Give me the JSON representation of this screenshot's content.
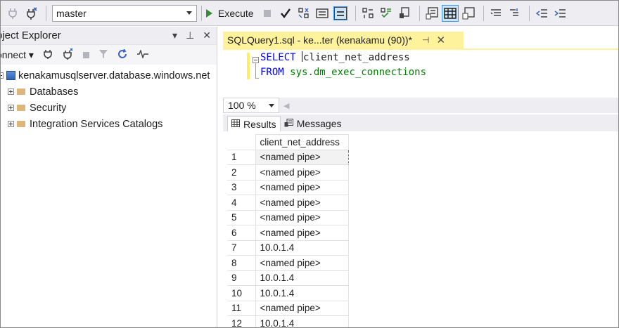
{
  "toolbar": {
    "database_value": "master",
    "execute_label": "Execute"
  },
  "object_explorer": {
    "title": "Object Explorer",
    "title_visible": "bject Explorer",
    "connect_label": "Connect",
    "connect_visible": "onnect",
    "server": "kenakamusqlserver.database.windows.net",
    "nodes": [
      "Databases",
      "Security",
      "Integration Services Catalogs"
    ]
  },
  "query": {
    "tab_title": "SQLQuery1.sql - ke...ter (kenakamu (90))*",
    "line1_keyword": "SELECT",
    "line1_rest": "client_net_address",
    "line2_keyword": "FROM",
    "line2_rest": "sys.dm_exec_connections",
    "zoom": "100 %"
  },
  "results": {
    "tab_results": "Results",
    "tab_messages": "Messages",
    "column": "client_net_address",
    "rows": [
      {
        "n": "1",
        "v": "<named pipe>"
      },
      {
        "n": "2",
        "v": "<named pipe>"
      },
      {
        "n": "3",
        "v": "<named pipe>"
      },
      {
        "n": "4",
        "v": "<named pipe>"
      },
      {
        "n": "5",
        "v": "<named pipe>"
      },
      {
        "n": "6",
        "v": "<named pipe>"
      },
      {
        "n": "7",
        "v": "10.0.1.4"
      },
      {
        "n": "8",
        "v": "<named pipe>"
      },
      {
        "n": "9",
        "v": "10.0.1.4"
      },
      {
        "n": "10",
        "v": "10.0.1.4"
      },
      {
        "n": "11",
        "v": "<named pipe>"
      },
      {
        "n": "12",
        "v": "10.0.1.4"
      }
    ]
  },
  "icons": {
    "toolbar": [
      "plug-icon",
      "disconnect-icon",
      "database-dropdown",
      "play-icon",
      "stop-icon",
      "checkmark-icon",
      "parse-icon",
      "results-to-text-icon",
      "results-to-grid-icon",
      "comment-icon",
      "uncomment-icon",
      "indent-icon",
      "outdent-icon"
    ],
    "object_explorer": [
      "connect-plug-icon",
      "disconnect-icon",
      "stop-icon",
      "filter-icon",
      "refresh-icon",
      "activity-monitor-icon"
    ]
  }
}
